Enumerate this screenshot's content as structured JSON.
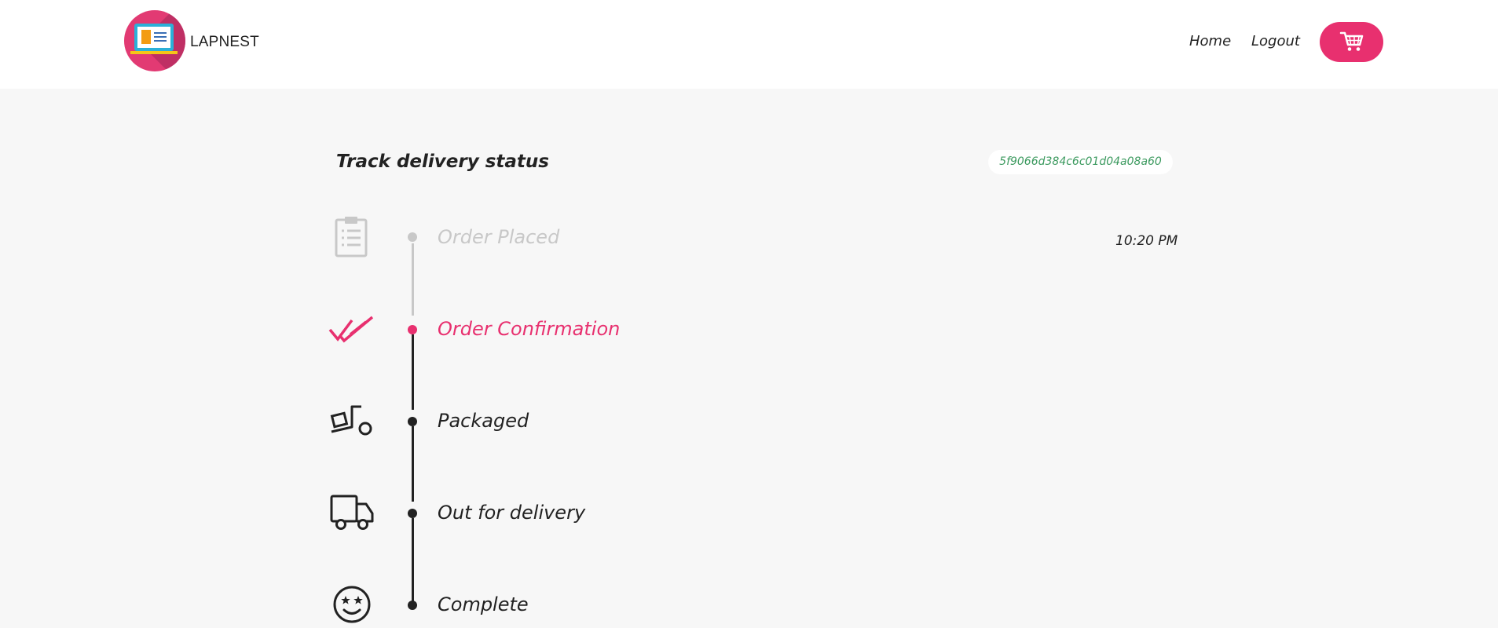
{
  "brand": {
    "name": "LAPNEST"
  },
  "nav": {
    "home_label": "Home",
    "logout_label": "Logout",
    "cart_icon": "cart-icon"
  },
  "tracking": {
    "title": "Track delivery status",
    "order_id": "5f9066d384c6c01d04a08a60",
    "time": "10:20 PM",
    "steps": [
      {
        "label": "Order Placed",
        "icon": "clipboard-icon",
        "state": "done"
      },
      {
        "label": "Order Confirmation",
        "icon": "double-check-icon",
        "state": "current"
      },
      {
        "label": "Packaged",
        "icon": "dolly-box-icon",
        "state": "pending"
      },
      {
        "label": "Out for delivery",
        "icon": "truck-icon",
        "state": "pending"
      },
      {
        "label": "Complete",
        "icon": "smiley-star-eyes-icon",
        "state": "pending"
      }
    ]
  },
  "colors": {
    "accent": "#e8306f",
    "done": "#c8c8c8",
    "pending": "#222222",
    "order_id": "#3c9a5f",
    "background": "#f7f7f7"
  }
}
